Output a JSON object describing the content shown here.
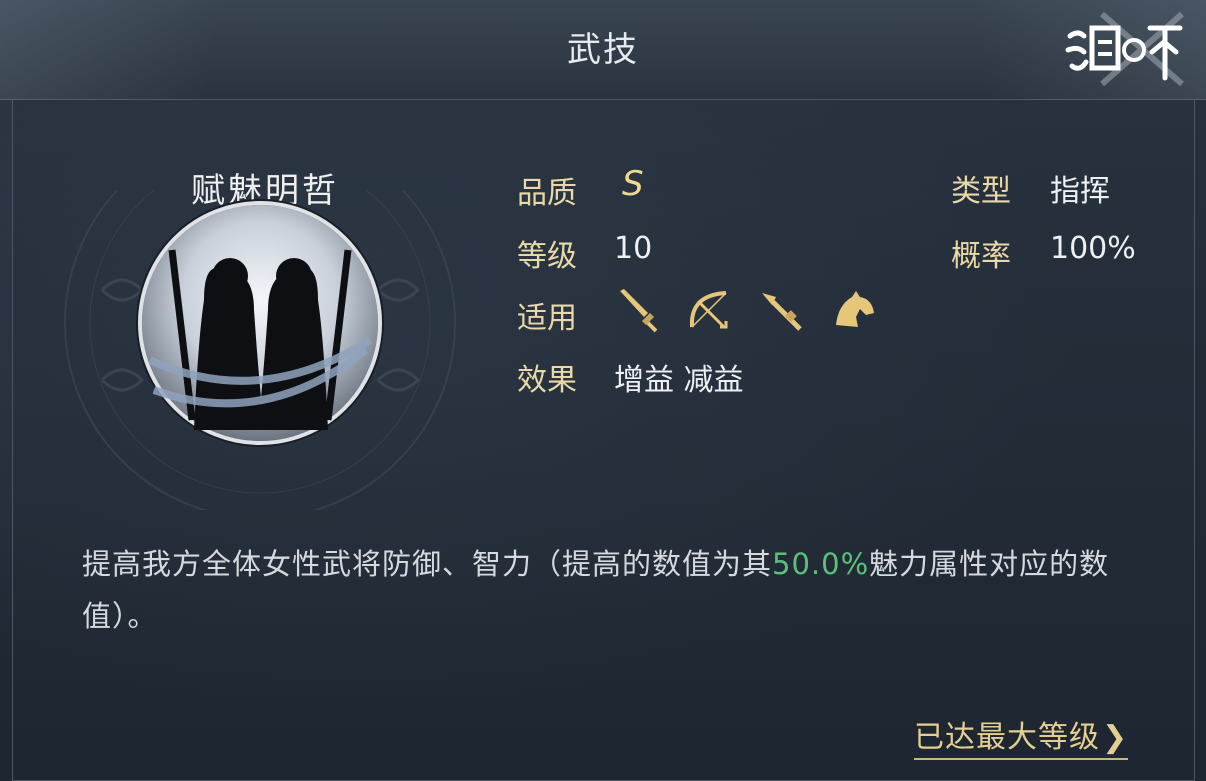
{
  "header": {
    "title": "武技"
  },
  "skill": {
    "name": "赋魅明哲"
  },
  "stats": {
    "quality_label": "品质",
    "quality_value": "S",
    "level_label": "等级",
    "level_value": "10",
    "applicable_label": "适用",
    "applicable_icons": [
      "sword-icon",
      "bow-icon",
      "spear-icon",
      "horse-icon"
    ],
    "effect_label": "效果",
    "effect_value": "增益 减益",
    "type_label": "类型",
    "type_value": "指挥",
    "chance_label": "概率",
    "chance_value": "100%"
  },
  "description": {
    "part1": "提高我方全体女性武将防御、智力（提高的数值为其",
    "highlight": "50.0%",
    "part2": "魅力属性对应的数值）。"
  },
  "footer": {
    "max_level_label": "已达最大等级",
    "arrow": "❯"
  },
  "colors": {
    "label_gold": "#e9d9a6",
    "highlight_green": "#5cc07a",
    "link_gold": "#e4cf90"
  }
}
